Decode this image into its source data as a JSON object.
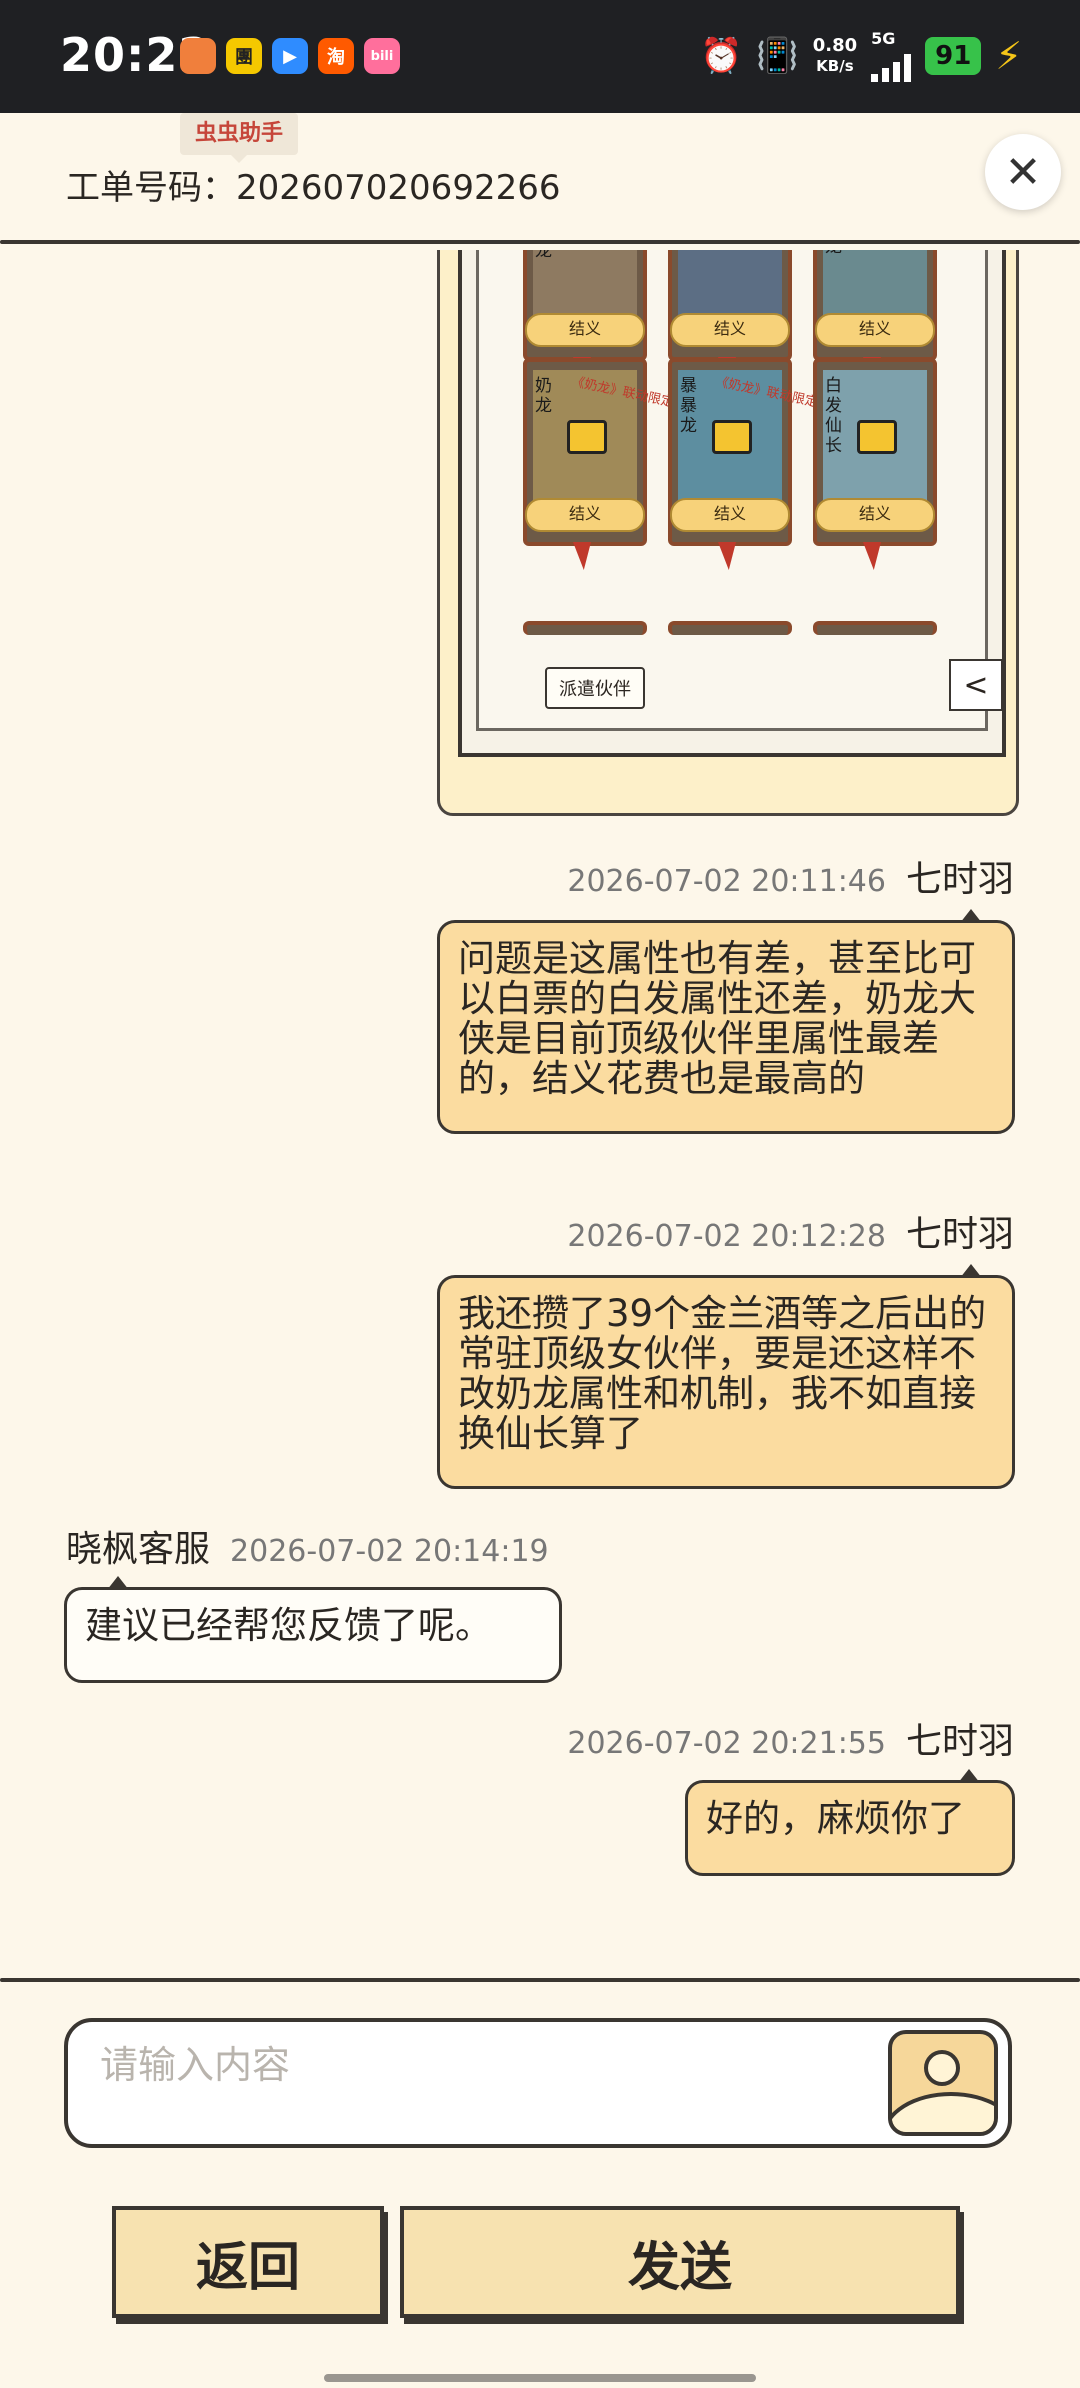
{
  "status_bar": {
    "time": "20:22",
    "net_speed_value": "0.80",
    "net_speed_unit": "KB/s",
    "network": "5G",
    "battery": "91",
    "apps": [
      {
        "label": "",
        "color": "#f07f3c"
      },
      {
        "label": "團",
        "color": "#f5c800"
      },
      {
        "label": "▶",
        "color": "#2f8cff"
      },
      {
        "label": "淘",
        "color": "#ff5a00"
      },
      {
        "label": "bili",
        "color": "#ff6f9c"
      }
    ]
  },
  "header": {
    "tooltip": "虫虫助手",
    "ticket_label": "工单号码：202607020692266"
  },
  "game_image": {
    "cards_top": [
      {
        "name": "奶龙",
        "button": "结义"
      },
      {
        "name": "",
        "button": "结义"
      },
      {
        "name": "龙",
        "button": "结义"
      }
    ],
    "cards_mid": [
      {
        "name": "奶龙",
        "button": "结义"
      },
      {
        "name": "暴暴龙",
        "button": "结义"
      },
      {
        "name": "白发仙长",
        "button": "结义"
      }
    ],
    "limited_tag": "《奶龙》联动限定",
    "dispatch_button": "派遣伙伴",
    "back_glyph": "<"
  },
  "messages": [
    {
      "time": "2026-07-02 20:11:46",
      "sender": "七时羽",
      "text": "问题是这属性也有差，甚至比可以白票的白发属性还差，奶龙大侠是目前顶级伙伴里属性最差的，结义花费也是最高的"
    },
    {
      "time": "2026-07-02 20:12:28",
      "sender": "七时羽",
      "text": "我还攒了39个金兰酒等之后出的常驻顶级女伙伴，要是还这样不改奶龙属性和机制，我不如直接换仙长算了"
    },
    {
      "time": "2026-07-02 20:14:19",
      "sender": "晓枫客服",
      "text": "建议已经帮您反馈了呢。"
    },
    {
      "time": "2026-07-02 20:21:55",
      "sender": "七时羽",
      "text": "好的，麻烦你了"
    }
  ],
  "composer": {
    "placeholder": "请输入内容",
    "back_button": "返回",
    "send_button": "发送"
  }
}
